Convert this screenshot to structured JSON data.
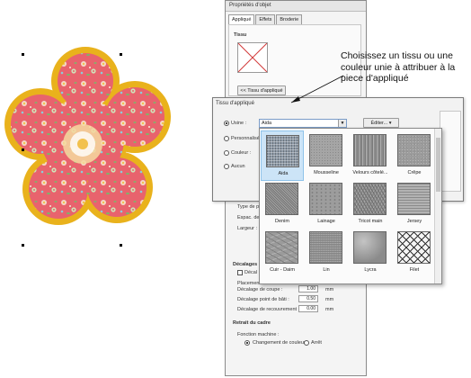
{
  "properties_panel": {
    "title": "Propriétés d'objet",
    "tabs": [
      {
        "label": "Appliqué",
        "active": true
      },
      {
        "label": "Effets",
        "active": false
      },
      {
        "label": "Broderie",
        "active": false
      }
    ],
    "fabric_group": "Tissu",
    "fabric_button": "<< Tissu d'appliqué",
    "partial_labels": {
      "type": "Type de p",
      "spacing": "Espac. de",
      "width": "Largeur :"
    },
    "offsets_group": "Décalages",
    "offsets_checkbox": "Décal",
    "placement_label": "Placement",
    "offsets": [
      {
        "label": "Décalage de coupe :",
        "value": "1.00",
        "unit": "mm"
      },
      {
        "label": "Décalage point de bâti :",
        "value": "0.50",
        "unit": "mm"
      },
      {
        "label": "Décalage de recouvrement :",
        "value": "0.00",
        "unit": "mm"
      }
    ],
    "frame_group": "Retrait du cadre",
    "machine_function_label": "Fonction machine :",
    "machine_options": [
      {
        "label": "Changement de couleur",
        "selected": true
      },
      {
        "label": "Arrêt",
        "selected": false
      }
    ]
  },
  "dialog": {
    "title": "Tissu d'appliqué",
    "options": [
      {
        "label": "Usine :",
        "selected": true
      },
      {
        "label": "Personnalisé :",
        "selected": false
      },
      {
        "label": "Couleur :",
        "selected": false
      },
      {
        "label": "Aucun",
        "selected": false
      }
    ],
    "selected_fabric": "Aida",
    "edit_button": "Éditer..."
  },
  "gallery": {
    "items": [
      {
        "label": "Aida",
        "texture": "aida",
        "selected": true
      },
      {
        "label": "Mousseline",
        "texture": "mousseline",
        "selected": false
      },
      {
        "label": "Velours côtelé...",
        "texture": "velours",
        "selected": false
      },
      {
        "label": "Crêpe",
        "texture": "crepe",
        "selected": false
      },
      {
        "label": "Denim",
        "texture": "denim",
        "selected": false
      },
      {
        "label": "Lainage",
        "texture": "lainage",
        "selected": false
      },
      {
        "label": "Tricot main",
        "texture": "tricot",
        "selected": false
      },
      {
        "label": "Jersey",
        "texture": "jersey",
        "selected": false
      },
      {
        "label": "Cuir - Daim",
        "texture": "cuir",
        "selected": false
      },
      {
        "label": "Lin",
        "texture": "lin",
        "selected": false
      },
      {
        "label": "Lycra",
        "texture": "lycra",
        "selected": false
      },
      {
        "label": "Filet",
        "texture": "filet",
        "selected": false
      }
    ]
  },
  "callout": {
    "text": "Choisissez un tissu ou une couleur unie à attribuer à la piece d'appliqué"
  },
  "colors": {
    "flower_fill": "#e8636d",
    "flower_border": "#e9b21c",
    "selection_blue": "#cce4f7",
    "dialog_bg": "#f2f2f2"
  }
}
